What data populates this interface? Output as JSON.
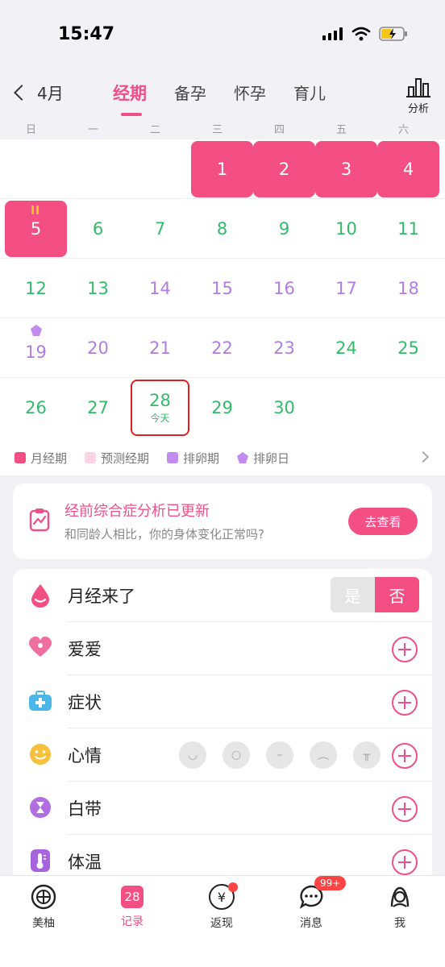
{
  "status_bar": {
    "time": "15:47"
  },
  "nav": {
    "month": "4月",
    "tabs": [
      "经期",
      "备孕",
      "怀孕",
      "育儿"
    ],
    "active_tab": 0,
    "analysis_label": "分析"
  },
  "weekdays": [
    "日",
    "一",
    "二",
    "三",
    "四",
    "五",
    "六"
  ],
  "calendar": {
    "weeks": [
      [
        null,
        null,
        null,
        {
          "n": "1",
          "t": "period"
        },
        {
          "n": "2",
          "t": "period"
        },
        {
          "n": "3",
          "t": "period"
        },
        {
          "n": "4",
          "t": "period"
        }
      ],
      [
        {
          "n": "5",
          "t": "period"
        },
        {
          "n": "6",
          "t": "green"
        },
        {
          "n": "7",
          "t": "green"
        },
        {
          "n": "8",
          "t": "green"
        },
        {
          "n": "9",
          "t": "green"
        },
        {
          "n": "10",
          "t": "green"
        },
        {
          "n": "11",
          "t": "green"
        }
      ],
      [
        {
          "n": "12",
          "t": "green"
        },
        {
          "n": "13",
          "t": "green"
        },
        {
          "n": "14",
          "t": "purple"
        },
        {
          "n": "15",
          "t": "purple"
        },
        {
          "n": "16",
          "t": "purple"
        },
        {
          "n": "17",
          "t": "purple"
        },
        {
          "n": "18",
          "t": "purple"
        }
      ],
      [
        {
          "n": "19",
          "t": "purple"
        },
        {
          "n": "20",
          "t": "purple"
        },
        {
          "n": "21",
          "t": "purple"
        },
        {
          "n": "22",
          "t": "purple"
        },
        {
          "n": "23",
          "t": "purple"
        },
        {
          "n": "24",
          "t": "green"
        },
        {
          "n": "25",
          "t": "green"
        }
      ],
      [
        {
          "n": "26",
          "t": "green"
        },
        {
          "n": "27",
          "t": "green"
        },
        {
          "n": "28",
          "t": "green",
          "today": true
        },
        {
          "n": "29",
          "t": "green"
        },
        {
          "n": "30",
          "t": "green"
        },
        null,
        null
      ]
    ],
    "today_label": "今天"
  },
  "legend": [
    {
      "label": "月经期",
      "color": "#f34f83"
    },
    {
      "label": "预测经期",
      "color": "#fcd4e2"
    },
    {
      "label": "排卵期",
      "color": "#c18cf0"
    },
    {
      "label": "排卵日",
      "color": "#c18cf0"
    }
  ],
  "pms_card": {
    "title": "经前综合症分析已更新",
    "subtitle": "和同龄人相比，你的身体变化正常吗?",
    "button": "去查看"
  },
  "records": {
    "period_came": "月经来了",
    "toggle_yes": "是",
    "toggle_no": "否",
    "love": "爱爱",
    "symptoms": "症状",
    "mood": "心情",
    "discharge": "白带",
    "temperature": "体温"
  },
  "tabbar": {
    "items": [
      "美柚",
      "记录",
      "返现",
      "消息",
      "我"
    ],
    "record_day": "28",
    "messages_badge": "99+",
    "cashback_symbol": "¥"
  },
  "colors": {
    "accent": "#f34f83",
    "green": "#33bb6a",
    "purple": "#b27ce0"
  }
}
